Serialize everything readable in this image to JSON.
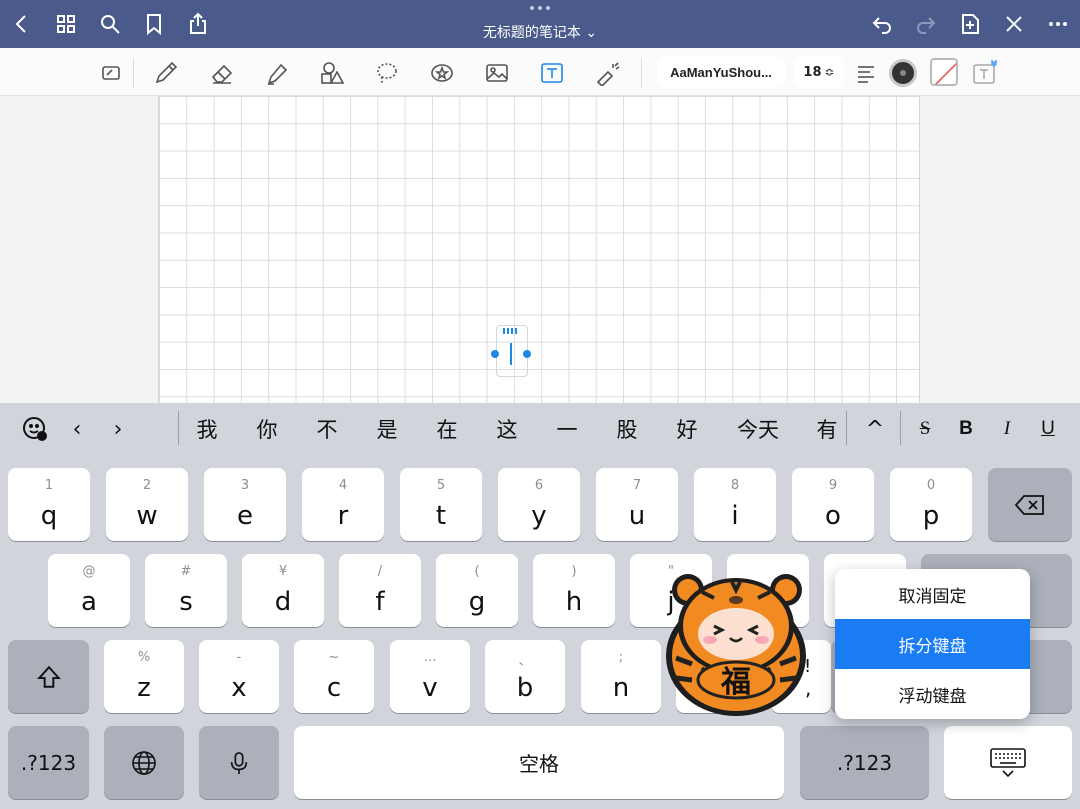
{
  "topbar": {
    "title": "无标题的笔记本",
    "title_chevron": "⌄",
    "icons": [
      "back-icon",
      "grid-icon",
      "search-icon",
      "bookmark-icon",
      "share-icon",
      "undo-icon",
      "redo-icon",
      "add-page-icon",
      "close-tools-icon",
      "more-icon"
    ]
  },
  "toolbar": {
    "tools": [
      "shape-recognition-icon",
      "pen-icon",
      "eraser-icon",
      "highlighter-icon",
      "shapes-icon",
      "lasso-icon",
      "sticker-icon",
      "image-icon",
      "text-icon",
      "laser-pointer-icon"
    ],
    "active_tool": "text-icon",
    "font_name": "AaManYuShou...",
    "font_size": "18",
    "size_stepper_glyph": "≎",
    "text_color": "#333333",
    "accent": "#1e88e5"
  },
  "suggestions": {
    "candidates": [
      "我",
      "你",
      "不",
      "是",
      "在",
      "这",
      "一",
      "股",
      "好",
      "今天",
      "有"
    ],
    "expand": "^",
    "format": {
      "strike": "S",
      "bold": "B",
      "italic": "I",
      "underline": "U"
    }
  },
  "keyboard": {
    "row1": [
      {
        "hint": "1",
        "key": "q"
      },
      {
        "hint": "2",
        "key": "w"
      },
      {
        "hint": "3",
        "key": "e"
      },
      {
        "hint": "4",
        "key": "r"
      },
      {
        "hint": "5",
        "key": "t"
      },
      {
        "hint": "6",
        "key": "y"
      },
      {
        "hint": "7",
        "key": "u"
      },
      {
        "hint": "8",
        "key": "i"
      },
      {
        "hint": "9",
        "key": "o"
      },
      {
        "hint": "0",
        "key": "p"
      }
    ],
    "row2": [
      {
        "hint": "@",
        "key": "a"
      },
      {
        "hint": "#",
        "key": "s"
      },
      {
        "hint": "¥",
        "key": "d"
      },
      {
        "hint": "/",
        "key": "f"
      },
      {
        "hint": "(",
        "key": "g"
      },
      {
        "hint": ")",
        "key": "h"
      },
      {
        "hint": "\"",
        "key": "j"
      }
    ],
    "row3": [
      {
        "hint": "%",
        "key": "z"
      },
      {
        "hint": "-",
        "key": "x"
      },
      {
        "hint": "~",
        "key": "c"
      },
      {
        "hint": "…",
        "key": "v"
      },
      {
        "hint": "、",
        "key": "b"
      },
      {
        "hint": ";",
        "key": "n"
      }
    ],
    "row3_partial": {
      "hint": "!",
      "key": ","
    },
    "numbers_left": ".?123",
    "numbers_right": ".?123",
    "space": "空格"
  },
  "popup_menu": {
    "items": [
      "取消固定",
      "拆分键盘",
      "浮动键盘"
    ],
    "selected": "拆分键盘"
  },
  "sticker": {
    "text": "福"
  }
}
